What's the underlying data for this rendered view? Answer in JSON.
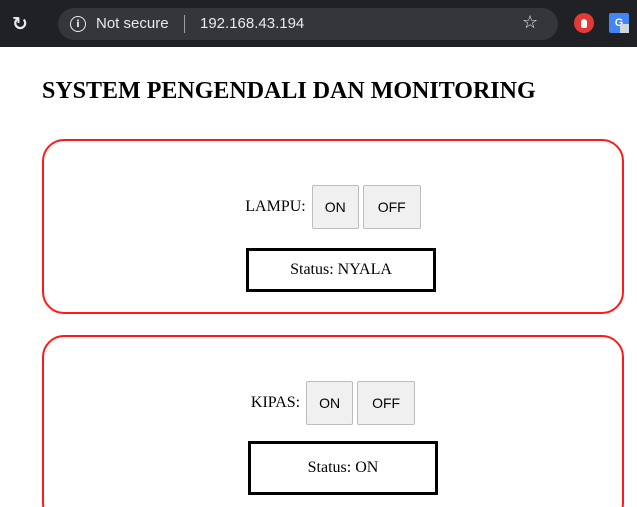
{
  "browser": {
    "security_label": "Not secure",
    "url": "192.168.43.194",
    "info_glyph": "i",
    "translate_glyph": "G",
    "icons": [
      "reload-icon",
      "info-icon",
      "bookmark-star-icon",
      "extension-red-icon",
      "translate-icon"
    ]
  },
  "page": {
    "title": "SYSTEM PENGENDALI DAN MONITORING"
  },
  "devices": [
    {
      "label": "LAMPU:",
      "on_label": "ON",
      "off_label": "OFF",
      "status_text": "Status: NYALA"
    },
    {
      "label": "KIPAS:",
      "on_label": "ON",
      "off_label": "OFF",
      "status_text": "Status: ON"
    }
  ],
  "colors": {
    "panel_border": "#ff1a1a",
    "chrome_bg": "#202124"
  }
}
